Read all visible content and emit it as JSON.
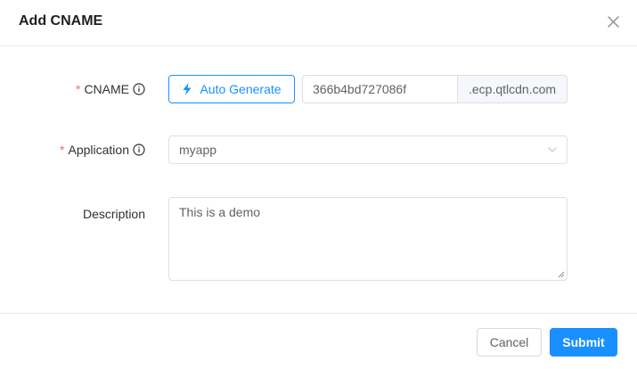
{
  "dialog": {
    "title": "Add CNAME"
  },
  "form": {
    "cname": {
      "label": "CNAME",
      "required_mark": "*",
      "auto_generate_label": "Auto Generate",
      "value": "366b4bd727086f",
      "suffix": ".ecp.qtlcdn.com"
    },
    "application": {
      "label": "Application",
      "required_mark": "*",
      "selected": "myapp"
    },
    "description": {
      "label": "Description",
      "value": "This is a demo"
    }
  },
  "footer": {
    "cancel_label": "Cancel",
    "submit_label": "Submit"
  },
  "colors": {
    "accent": "#1890ff",
    "required": "#f56c6c"
  },
  "icons": {
    "close": "close-icon",
    "info": "info-icon",
    "bolt": "lightning-icon",
    "chevron": "chevron-down-icon"
  }
}
